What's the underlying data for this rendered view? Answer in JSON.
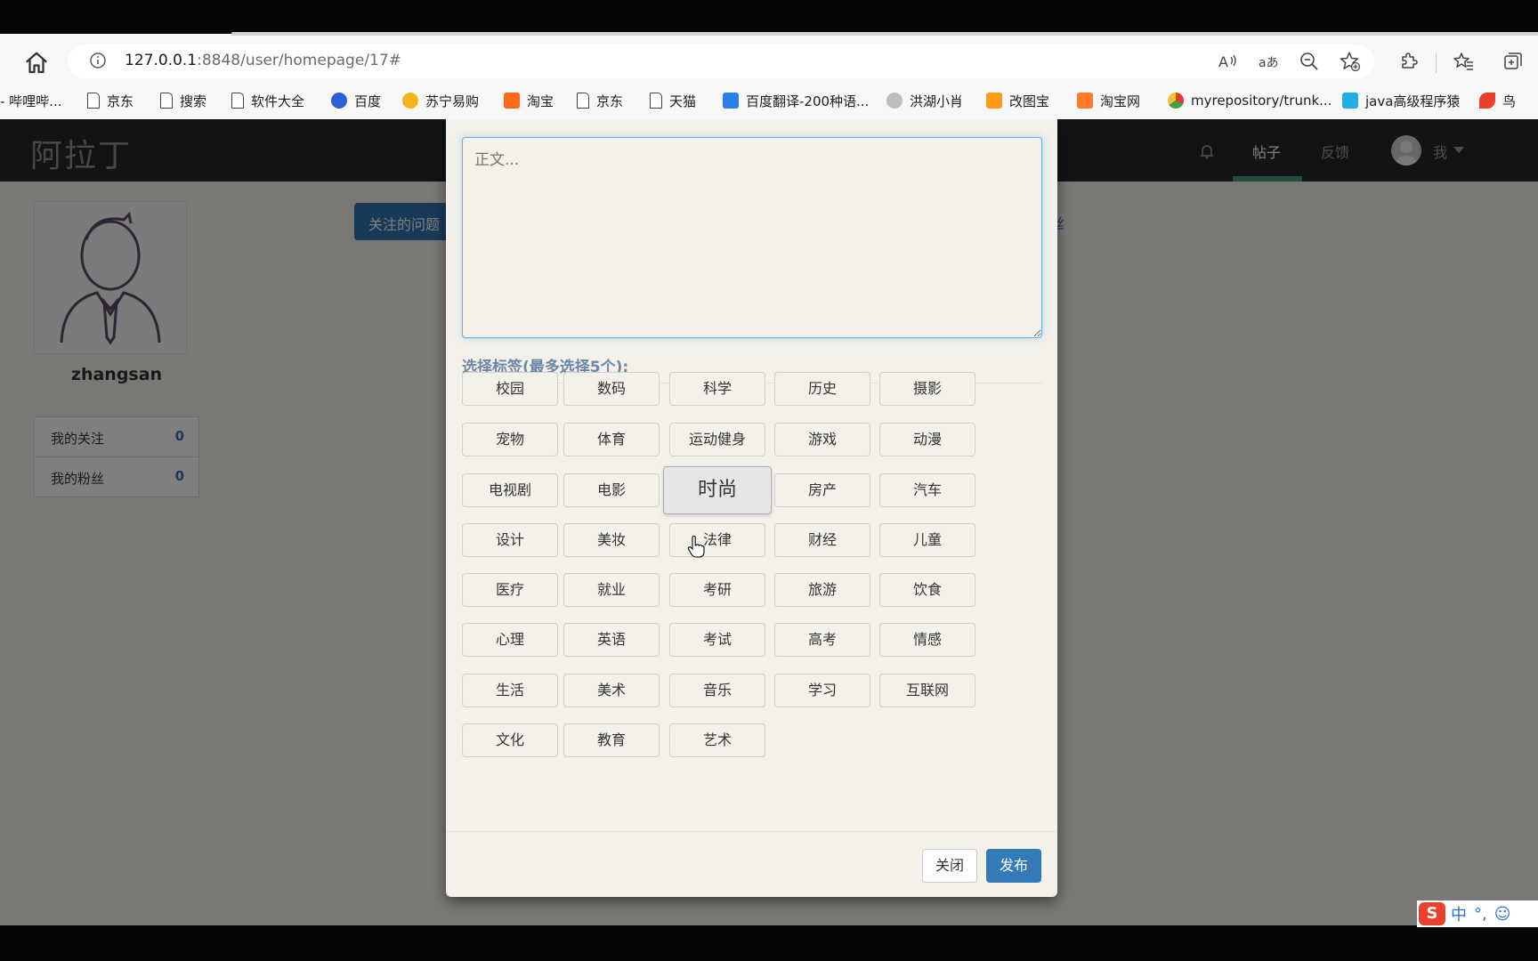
{
  "browser": {
    "url_host": "127.0.0.1",
    "url_path": ":8848/user/homepage/17#",
    "bookmarks": [
      {
        "label": "- 哔哩哔...",
        "icon": "bilibili-icon"
      },
      {
        "label": "京东",
        "icon": "page-icon"
      },
      {
        "label": "搜索",
        "icon": "page-icon"
      },
      {
        "label": "软件大全",
        "icon": "page-icon"
      },
      {
        "label": "百度",
        "icon": "baidu-icon"
      },
      {
        "label": "苏宁易购",
        "icon": "suning-icon"
      },
      {
        "label": "淘宝",
        "icon": "taobao-icon"
      },
      {
        "label": "京东",
        "icon": "page-icon"
      },
      {
        "label": "天猫",
        "icon": "page-icon"
      },
      {
        "label": "百度翻译-200种语...",
        "icon": "translate-icon"
      },
      {
        "label": "洪湖小肖",
        "icon": "bird-icon"
      },
      {
        "label": "改图宝",
        "icon": "gaitubao-icon"
      },
      {
        "label": "淘宝网",
        "icon": "taobao-icon"
      },
      {
        "label": "myrepository/trunk...",
        "icon": "chrome-icon"
      },
      {
        "label": "java高级程序猿",
        "icon": "bilibili-tv-icon"
      },
      {
        "label": "鸟",
        "icon": "bird-red-icon"
      }
    ]
  },
  "app": {
    "logo": "阿拉丁",
    "nav": {
      "posts": "帖子",
      "feedback": "反馈",
      "me": "我"
    }
  },
  "profile": {
    "username": "zhangsan",
    "stats": [
      {
        "label": "我的关注",
        "value": "0"
      },
      {
        "label": "我的粉丝",
        "value": "0"
      }
    ],
    "follow_button": "关注的问题",
    "fans_link": "丝"
  },
  "modal": {
    "textarea_placeholder": "正文...",
    "tags_label": "选择标签(最多选择5个):",
    "tags": [
      "校园",
      "数码",
      "科学",
      "历史",
      "摄影",
      "宠物",
      "体育",
      "运动健身",
      "游戏",
      "动漫",
      "电视剧",
      "电影",
      "时尚",
      "房产",
      "汽车",
      "设计",
      "美妆",
      "法律",
      "财经",
      "儿童",
      "医疗",
      "就业",
      "考研",
      "旅游",
      "饮食",
      "心理",
      "英语",
      "考试",
      "高考",
      "情感",
      "生活",
      "美术",
      "音乐",
      "学习",
      "互联网",
      "文化",
      "教育",
      "艺术"
    ],
    "hovered_tag": "时尚",
    "close_label": "关闭",
    "publish_label": "发布"
  },
  "ime": {
    "label": "中"
  },
  "colors": {
    "primary": "#337ab7",
    "navbar": "#222629",
    "nav_active": "#3f9a6e"
  }
}
